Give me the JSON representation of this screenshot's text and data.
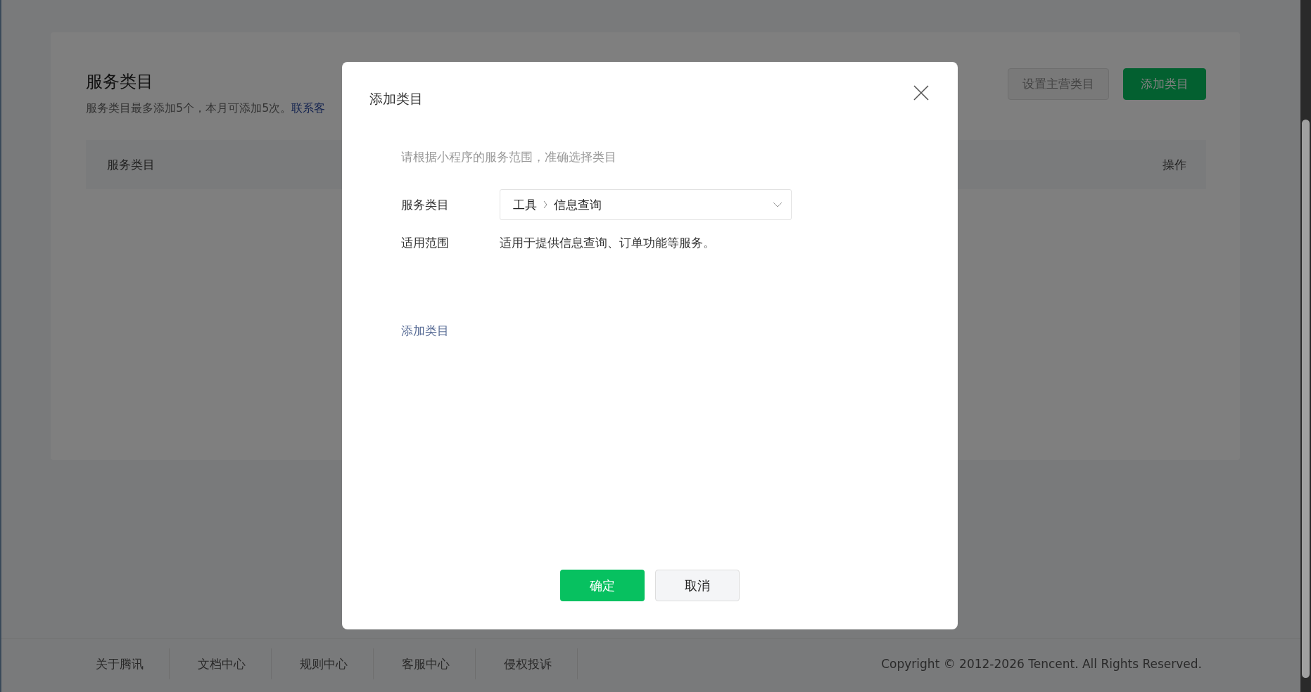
{
  "page": {
    "title": "服务类目",
    "description": "服务类目最多添加5个，本月可添加5次。",
    "link": "联系客",
    "buttons": [
      {
        "label": "设置主营类目",
        "disabled": true
      },
      {
        "label": "添加类目",
        "disabled": false
      }
    ],
    "table": {
      "columns": [
        "服务类目",
        "操作"
      ]
    }
  },
  "dialog": {
    "title": "添加类目",
    "hint": "请根据小程序的服务范围，准确选择类目",
    "fields": [
      {
        "kind": "select",
        "label": "服务类目",
        "path": [
          "工具",
          "信息查询"
        ]
      },
      {
        "kind": "text",
        "label": "适用范围",
        "value": "适用于提供信息查询、订单功能等服务。"
      }
    ],
    "add_link": "添加类目",
    "buttons": [
      {
        "label": "确定",
        "primary": true
      },
      {
        "label": "取消",
        "primary": false
      }
    ]
  },
  "footer": {
    "links": [
      "关于腾讯",
      "文档中心",
      "规则中心",
      "客服中心",
      "侵权投诉"
    ],
    "copyright": "Copyright © 2012-2026 Tencent. All Rights Reserved."
  }
}
